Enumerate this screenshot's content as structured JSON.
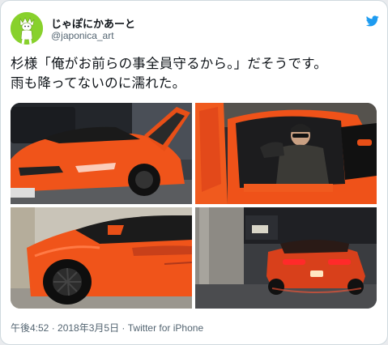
{
  "user": {
    "display_name": "じゃぽにかあーと",
    "handle": "@japonica_art",
    "avatar": "avatar-cartoon-figure"
  },
  "icons": {
    "brand": "twitter-bird-icon"
  },
  "tweet": {
    "text_line1": "杉様「俺がお前らの事全員守るから。」だそうです。",
    "text_line2": "雨も降ってないのに濡れた。"
  },
  "media": {
    "photos": [
      {
        "subject": "orange-supercar-doors-open"
      },
      {
        "subject": "driver-seated-in-orange-supercar"
      },
      {
        "subject": "orange-supercar-side-closeup"
      },
      {
        "subject": "orange-supercar-rear-lights-night"
      }
    ]
  },
  "meta": {
    "time": "午後4:52",
    "separator1": " · ",
    "date": "2018年3月5日",
    "separator2": " · ",
    "source": "Twitter for iPhone"
  },
  "colors": {
    "brand_blue": "#1d9bf0",
    "avatar_green": "#88d12c",
    "car_orange": "#f0541a",
    "text_primary": "#0f1419",
    "text_secondary": "#536471"
  }
}
